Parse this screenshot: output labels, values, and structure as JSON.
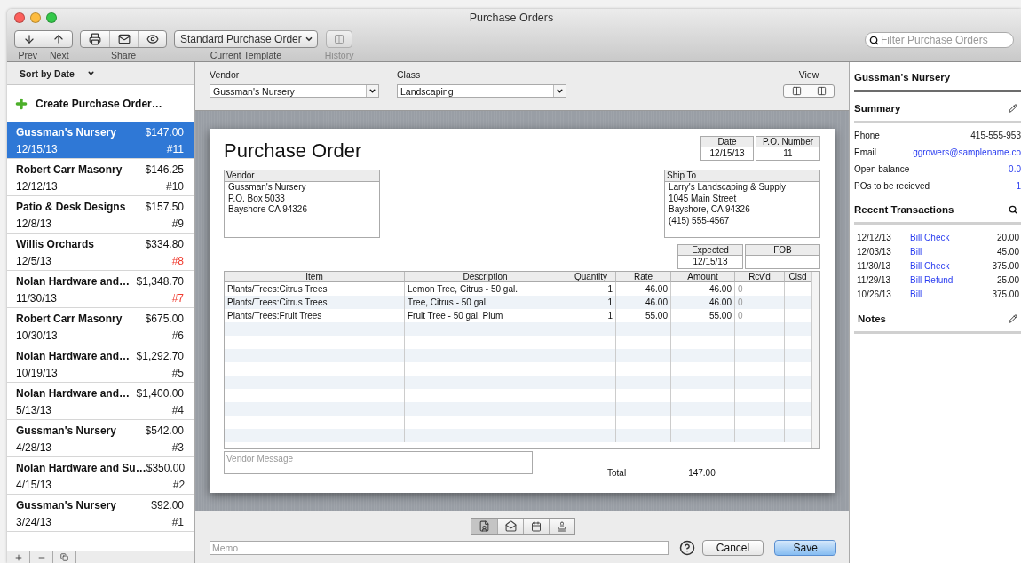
{
  "window": {
    "title": "Purchase Orders"
  },
  "toolbar": {
    "prev": "Prev",
    "next": "Next",
    "share": "Share",
    "template": {
      "value": "Standard Purchase Order",
      "label": "Current Template"
    },
    "history": {
      "label": "History",
      "disabled": true
    },
    "search": {
      "placeholder": "Filter Purchase Orders"
    }
  },
  "sidebar": {
    "sort": "Sort by Date",
    "create": "Create Purchase Order…",
    "items": [
      {
        "name": "Gussman's Nursery",
        "amount": "$147.00",
        "date": "12/15/13",
        "number": "#11",
        "overdue": false,
        "selected": true
      },
      {
        "name": "Robert Carr Masonry",
        "amount": "$146.25",
        "date": "12/12/13",
        "number": "#10",
        "overdue": false,
        "selected": false
      },
      {
        "name": "Patio & Desk Designs",
        "amount": "$157.50",
        "date": "12/8/13",
        "number": "#9",
        "overdue": false,
        "selected": false
      },
      {
        "name": "Willis Orchards",
        "amount": "$334.80",
        "date": "12/5/13",
        "number": "#8",
        "overdue": true,
        "selected": false
      },
      {
        "name": "Nolan Hardware and…",
        "amount": "$1,348.70",
        "date": "11/30/13",
        "number": "#7",
        "overdue": true,
        "selected": false
      },
      {
        "name": "Robert Carr Masonry",
        "amount": "$675.00",
        "date": "10/30/13",
        "number": "#6",
        "overdue": false,
        "selected": false
      },
      {
        "name": "Nolan Hardware and…",
        "amount": "$1,292.70",
        "date": "10/19/13",
        "number": "#5",
        "overdue": false,
        "selected": false
      },
      {
        "name": "Nolan Hardware and…",
        "amount": "$1,400.00",
        "date": "5/13/13",
        "number": "#4",
        "overdue": false,
        "selected": false
      },
      {
        "name": "Gussman's Nursery",
        "amount": "$542.00",
        "date": "4/28/13",
        "number": "#3",
        "overdue": false,
        "selected": false
      },
      {
        "name": "Nolan Hardware and Su…",
        "amount": "$350.00",
        "date": "4/15/13",
        "number": "#2",
        "overdue": false,
        "selected": false
      },
      {
        "name": "Gussman's Nursery",
        "amount": "$92.00",
        "date": "3/24/13",
        "number": "#1",
        "overdue": false,
        "selected": false
      }
    ]
  },
  "header": {
    "vendor": {
      "label": "Vendor",
      "value": "Gussman's Nursery"
    },
    "class": {
      "label": "Class",
      "value": "Landscaping"
    },
    "view": {
      "label": "View"
    }
  },
  "form": {
    "title": "Purchase Order",
    "date": {
      "label": "Date",
      "value": "12/15/13"
    },
    "po_number": {
      "label": "P.O. Number",
      "value": "11"
    },
    "vendor": {
      "label": "Vendor",
      "lines": [
        "Gussman's Nursery",
        "P.O. Box 5033",
        "Bayshore CA 94326"
      ]
    },
    "ship_to": {
      "label": "Ship To",
      "lines": [
        "Larry's Landscaping & Supply",
        "1045 Main Street",
        "Bayshore, CA 94326",
        "(415) 555-4567"
      ]
    },
    "expected": {
      "label": "Expected",
      "value": "12/15/13"
    },
    "fob": {
      "label": "FOB"
    },
    "table": {
      "columns": [
        "Item",
        "Description",
        "Quantity",
        "Rate",
        "Amount",
        "Rcv'd",
        "Clsd"
      ],
      "rows": [
        {
          "cells": [
            "Plants/Trees:Citrus Trees",
            "Lemon Tree, Citrus - 50 gal.",
            "1",
            "46.00",
            "46.00",
            "0"
          ]
        },
        {
          "cells": [
            "Plants/Trees:Citrus Trees",
            "Tree, Citrus - 50 gal.",
            "1",
            "46.00",
            "46.00",
            "0"
          ]
        },
        {
          "cells": [
            "Plants/Trees:Fruit Trees",
            "Fruit Tree - 50 gal. Plum",
            "1",
            "55.00",
            "55.00",
            "0"
          ]
        }
      ]
    },
    "vendor_message": {
      "placeholder": "Vendor Message"
    },
    "total": {
      "label": "Total",
      "value": "147.00"
    }
  },
  "footer": {
    "modes": [
      {
        "kind": "contact-doc",
        "selected": true
      },
      {
        "kind": "contact-mail",
        "selected": false
      },
      {
        "kind": "calendar",
        "selected": false
      },
      {
        "kind": "stamp",
        "selected": false
      }
    ],
    "memo": {
      "placeholder": "Memo"
    },
    "buttons": [
      {
        "label": "Cancel",
        "default": false
      },
      {
        "label": "Save",
        "default": true
      }
    ]
  },
  "details": {
    "name": "Gussman's Nursery",
    "summary": {
      "title": "Summary",
      "fields": [
        {
          "label": "Phone",
          "value": "415-555-953",
          "link": false
        },
        {
          "label": "Email",
          "value": "ggrowers@samplename.co",
          "link": true
        },
        {
          "label": "Open balance",
          "value": "0.0",
          "link": true
        },
        {
          "label": "POs to be recieved",
          "value": "1",
          "link": true
        }
      ]
    },
    "transactions": {
      "title": "Recent Transactions",
      "rows": [
        {
          "date": "12/12/13",
          "type": "Bill Check",
          "amount": "20.00"
        },
        {
          "date": "12/03/13",
          "type": "Bill",
          "amount": "45.00"
        },
        {
          "date": "11/30/13",
          "type": "Bill Check",
          "amount": "375.00"
        },
        {
          "date": "11/29/13",
          "type": "Bill Refund",
          "amount": "25.00"
        },
        {
          "date": "10/26/13",
          "type": "Bill",
          "amount": "375.00"
        }
      ]
    },
    "notes": {
      "title": "Notes"
    }
  }
}
